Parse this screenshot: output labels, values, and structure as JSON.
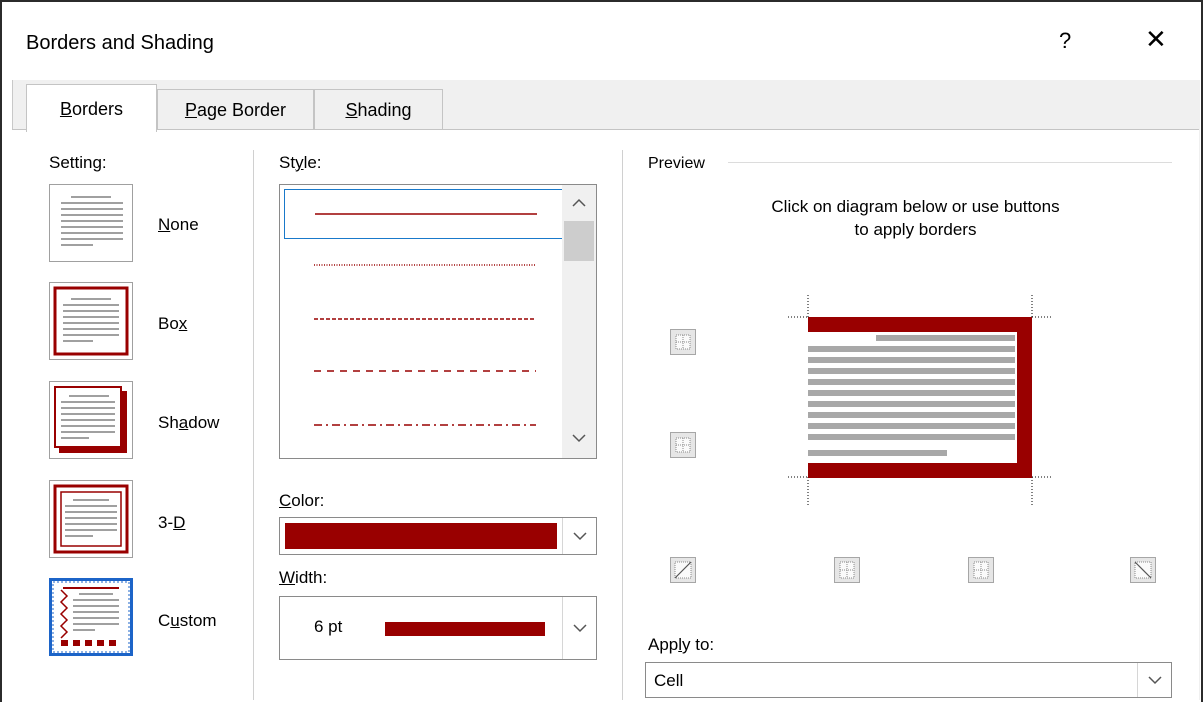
{
  "window": {
    "title": "Borders and Shading",
    "help_glyph": "?",
    "close_glyph": "✕"
  },
  "tabs": [
    {
      "label": "Borders",
      "mnemonic": "B",
      "rest": "orders",
      "active": true
    },
    {
      "label": "Page Border",
      "mnemonic": "P",
      "rest": "age Border"
    },
    {
      "label": "Shading",
      "mnemonic": "S",
      "rest": "hading"
    }
  ],
  "setting": {
    "label": "Setting:",
    "items": [
      {
        "label": "None",
        "pre": "",
        "mn": "N",
        "post": "one"
      },
      {
        "label": "Box",
        "pre": "Bo",
        "mn": "x",
        "post": ""
      },
      {
        "label": "Shadow",
        "pre": "Sh",
        "mn": "a",
        "post": "dow"
      },
      {
        "label": "3-D",
        "pre": "3-",
        "mn": "D",
        "post": ""
      },
      {
        "label": "Custom",
        "pre": "C",
        "mn": "u",
        "post": "stom"
      }
    ],
    "selected": "Custom"
  },
  "style": {
    "label": "Style:",
    "pre": "St",
    "mn": "y",
    "post": "le:",
    "items": [
      "solid",
      "dotted",
      "dashed-small",
      "dashed-large",
      "dash-dot"
    ],
    "selected": 0
  },
  "color": {
    "label": "Color:",
    "mn": "C",
    "post": "olor:",
    "value": "#990000"
  },
  "width": {
    "label": "Width:",
    "mn": "W",
    "post": "idth:",
    "value": "6 pt"
  },
  "preview": {
    "label": "Preview",
    "instruction_line1": "Click on diagram below or use buttons",
    "instruction_line2": "to apply borders"
  },
  "apply_to": {
    "label": "Apply to:",
    "pre": "App",
    "mn": "l",
    "post": "y to:",
    "value": "Cell"
  },
  "colors": {
    "accent": "#990000",
    "selection": "#1c64c8",
    "preview_lines": "#a8a8a8"
  },
  "icons": [
    "question-icon",
    "close-icon",
    "chevron-up-icon",
    "chevron-down-icon",
    "top-border-icon",
    "inside-horizontal-icon",
    "bottom-border-icon",
    "diagonal-up-icon",
    "left-border-icon",
    "inside-vertical-icon",
    "right-border-icon",
    "diagonal-down-icon"
  ]
}
